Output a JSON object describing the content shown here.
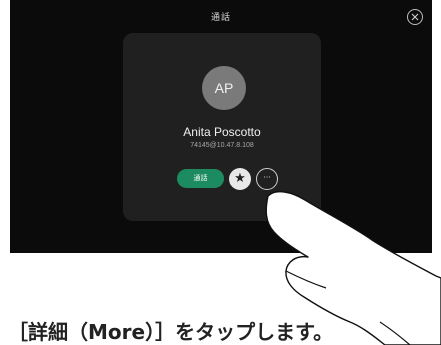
{
  "screen": {
    "title": "通話",
    "close_icon": "close-icon"
  },
  "contact": {
    "initials": "AP",
    "name": "Anita Poscotto",
    "address": "74145@10.47.8.108"
  },
  "actions": {
    "call_label": "通話",
    "favorite_icon": "star-icon",
    "more_label": "···"
  },
  "caption": {
    "text": "［詳細（More）］をタップします。"
  },
  "colors": {
    "call_button": "#1d8b62",
    "screen_bg": "#0b0b0b",
    "card_bg": "#202020"
  }
}
